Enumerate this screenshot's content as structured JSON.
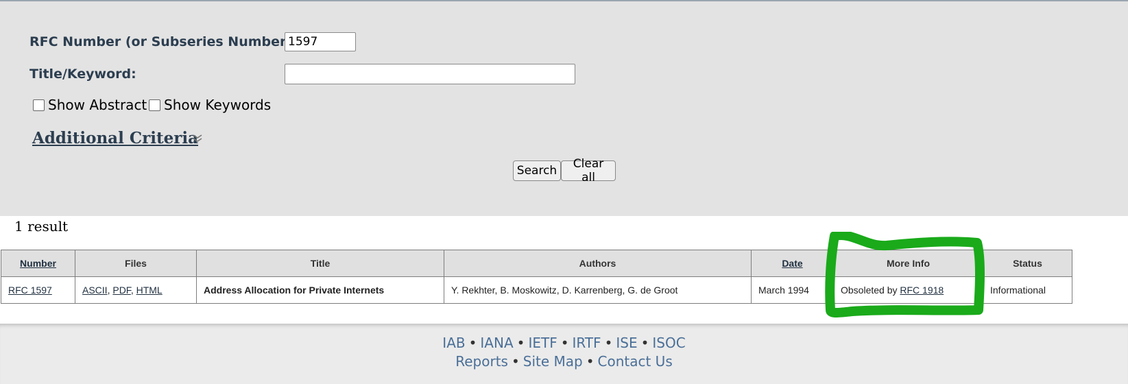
{
  "search": {
    "rfc_number_label": "RFC Number (or Subseries Number):",
    "rfc_number_value": "1597",
    "title_keyword_label": "Title/Keyword:",
    "title_keyword_value": "",
    "show_abstract_label": "Show Abstract",
    "show_keywords_label": "Show Keywords",
    "additional_criteria_label": "Additional Criteria",
    "search_button": "Search",
    "clear_button": "Clear all"
  },
  "results": {
    "count_text": "1 result",
    "headers": {
      "number": "Number",
      "files": "Files",
      "title": "Title",
      "authors": "Authors",
      "date": "Date",
      "more_info": "More Info",
      "status": "Status"
    },
    "rows": [
      {
        "number": "RFC 1597",
        "files": [
          "ASCII",
          "PDF",
          "HTML"
        ],
        "title": "Address Allocation for Private Internets",
        "authors": "Y. Rekhter, B. Moskowitz, D. Karrenberg, G. de Groot",
        "date": "March 1994",
        "more_info_prefix": "Obsoleted by",
        "more_info_link": "RFC 1918",
        "status": "Informational"
      }
    ]
  },
  "footer": {
    "links_row1": [
      "IAB",
      "IANA",
      "IETF",
      "IRTF",
      "ISE",
      "ISOC"
    ],
    "links_row2": [
      "Reports",
      "Site Map",
      "Contact Us"
    ],
    "separator": "•"
  },
  "colors": {
    "panel_bg": "#e3e3e3",
    "label_text": "#2c3e50",
    "footer_link": "#4a6f98",
    "annotation_green": "#1aaa1a"
  }
}
